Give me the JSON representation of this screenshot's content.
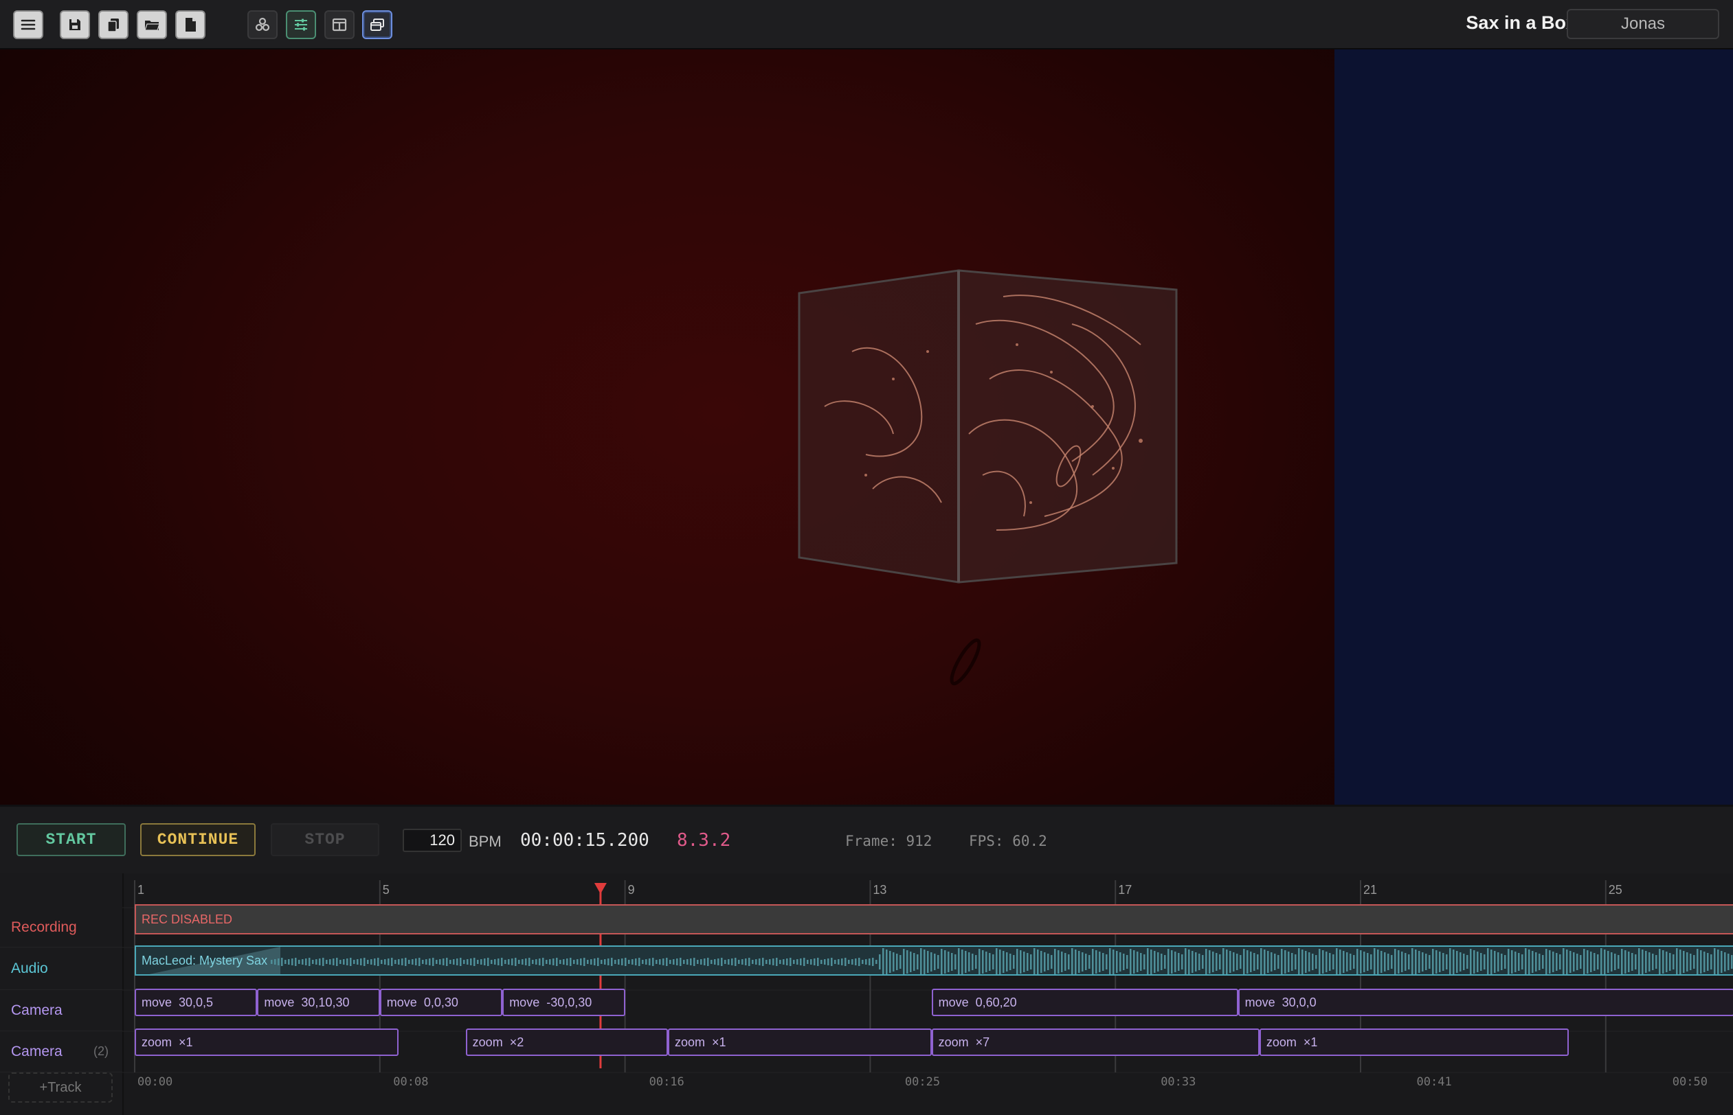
{
  "app": {
    "title": "Sax in a Box",
    "user": "Jonas"
  },
  "toolbar": {
    "left_group": [
      "menu-icon",
      "save-icon",
      "copy-icon",
      "open-folder-icon",
      "new-file-icon"
    ],
    "right_group": [
      "nodes-icon",
      "sliders-icon",
      "layout-panel-icon",
      "windows-icon"
    ]
  },
  "transport": {
    "start_label": "START",
    "continue_label": "CONTINUE",
    "stop_label": "STOP",
    "bpm_value": "120",
    "bpm_label": "BPM",
    "timecode": "00:00:15.200",
    "position": "8.3.2",
    "frame_text": "Frame: 912",
    "fps_text": "FPS: 60.2"
  },
  "timeline": {
    "bar_markers": [
      "1",
      "5",
      "9",
      "13",
      "17",
      "21",
      "25"
    ],
    "time_labels": [
      "00:00",
      "00:08",
      "00:16",
      "00:25",
      "00:33",
      "00:41",
      "00:50"
    ],
    "playhead_bar": 8.6,
    "tracks": [
      {
        "name": "Recording",
        "color": "#e05b5b"
      },
      {
        "name": "Audio",
        "color": "#5cc7d6"
      },
      {
        "name": "Camera",
        "color": "#b497f0"
      },
      {
        "name": "Camera",
        "color": "#b497f0",
        "count": "(2)"
      }
    ],
    "recording_label": "REC DISABLED",
    "audio_label": "MacLeod: Mystery Sax",
    "camera_clips": [
      {
        "label": "move  30,0,5",
        "start": 1,
        "end": 3
      },
      {
        "label": "move  30,10,30",
        "start": 3,
        "end": 5
      },
      {
        "label": "move  0,0,30",
        "start": 5,
        "end": 7
      },
      {
        "label": "move  -30,0,30",
        "start": 7,
        "end": 9
      },
      {
        "label": "move  0,60,20",
        "start": 14,
        "end": 19
      },
      {
        "label": "move  30,0,0",
        "start": 19,
        "end": 28
      }
    ],
    "camera2_clips": [
      {
        "label": "zoom  ×1",
        "start": 1,
        "end": 5.3
      },
      {
        "label": "zoom  ×2",
        "start": 6.4,
        "end": 9.7
      },
      {
        "label": "zoom  ×1",
        "start": 9.7,
        "end": 14
      },
      {
        "label": "zoom  ×7",
        "start": 14,
        "end": 19.35
      },
      {
        "label": "zoom  ×1",
        "start": 19.35,
        "end": 24.4
      }
    ],
    "add_track_label": "+Track"
  },
  "colors": {
    "accent_green": "#63c8a0",
    "accent_yellow": "#e8c156",
    "playhead": "#e03c3c",
    "clip_purple": "#8f62d1"
  }
}
